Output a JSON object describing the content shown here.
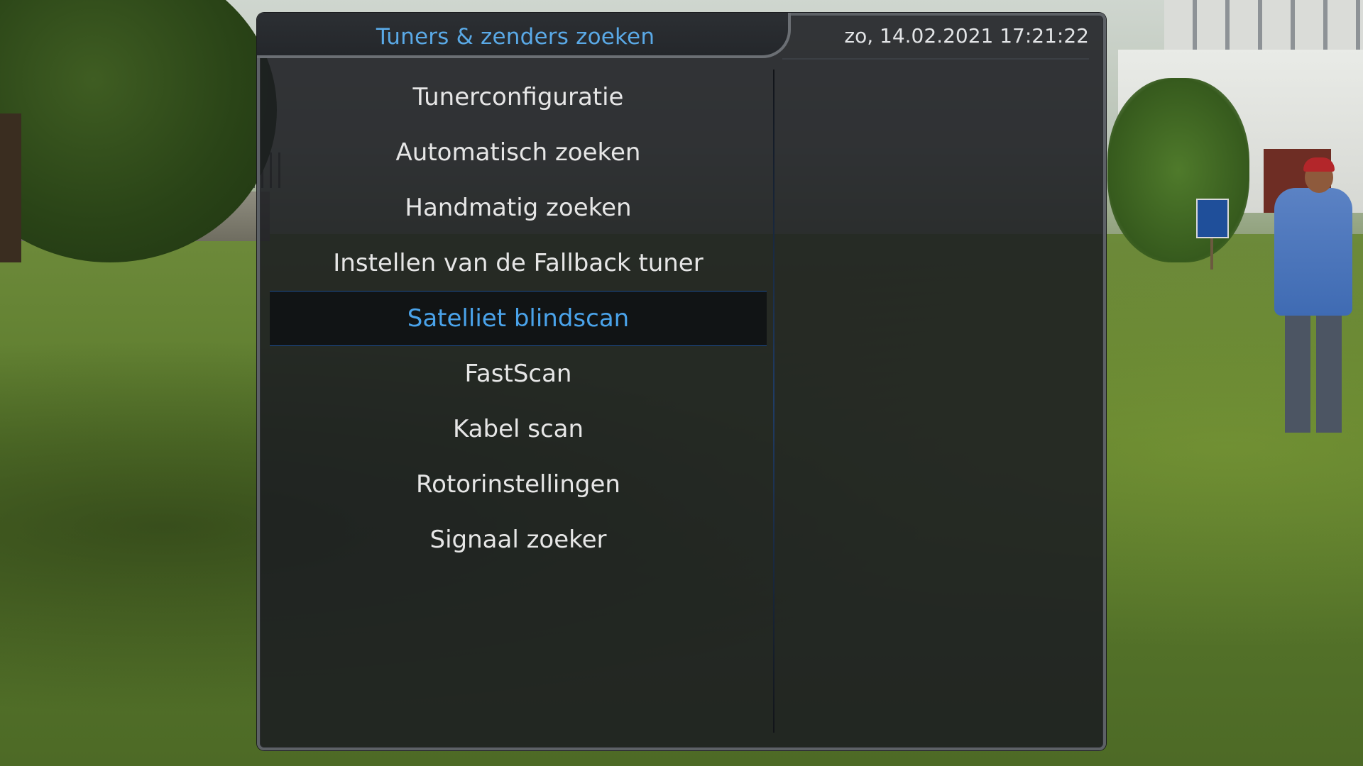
{
  "header": {
    "title": "Tuners & zenders zoeken",
    "datetime": "zo, 14.02.2021  17:21:22"
  },
  "menu": {
    "selected_index": 4,
    "items": [
      {
        "label": "Tunerconfiguratie"
      },
      {
        "label": "Automatisch zoeken"
      },
      {
        "label": "Handmatig zoeken"
      },
      {
        "label": "Instellen van de Fallback tuner"
      },
      {
        "label": "Satelliet blindscan"
      },
      {
        "label": "FastScan"
      },
      {
        "label": "Kabel scan"
      },
      {
        "label": "Rotorinstellingen"
      },
      {
        "label": "Signaal zoeker"
      }
    ]
  },
  "colors": {
    "accent": "#4aa3ea",
    "text": "#e6e6e6",
    "panel": "#1c1e22"
  }
}
